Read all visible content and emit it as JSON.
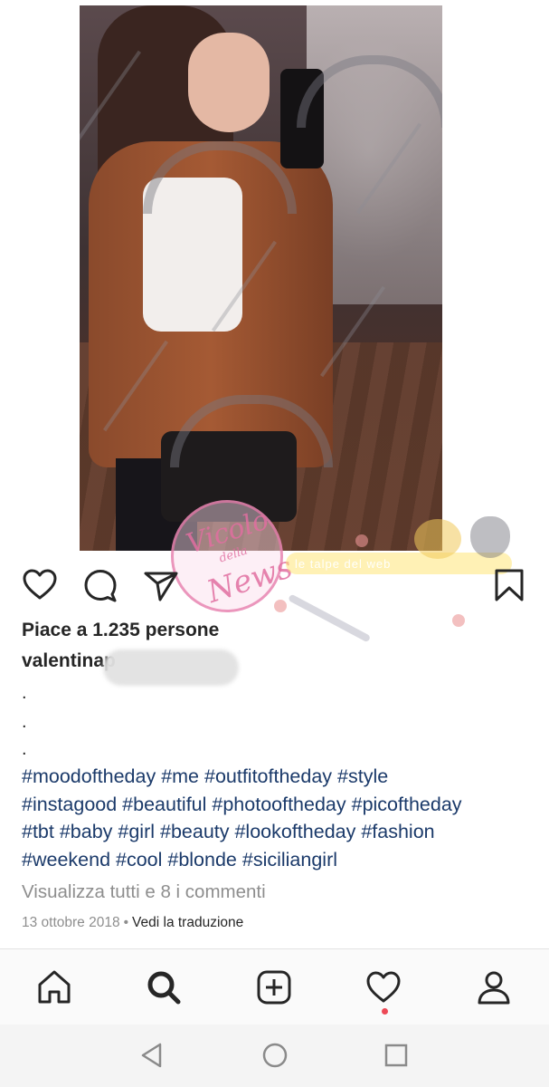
{
  "post": {
    "likes_text": "Piace a 1.235 persone",
    "username_visible": "valentinap",
    "caption_dots": [
      ".",
      ".",
      "."
    ],
    "hashtag_lines": [
      "#moodoftheday #me #outfitoftheday #style",
      "#instagood #beautiful #photooftheday #picoftheday",
      "#tbt #baby #girl #beauty #lookoftheday #fashion",
      "#weekend #cool #blonde #siciliangirl"
    ],
    "view_comments": "Visualizza tutti e 8 i commenti",
    "date": "13 ottobre 2018",
    "separator": "•",
    "translate_label": "Vedi la traduzione"
  },
  "watermark": {
    "line1": "Vicolo",
    "line2": "della",
    "line3": "News",
    "band_text": "le talpe del web"
  },
  "icons": {
    "like": "heart-icon",
    "comment": "comment-icon",
    "share": "send-icon",
    "save": "bookmark-icon",
    "nav_home": "home-icon",
    "nav_search": "search-icon",
    "nav_add": "add-post-icon",
    "nav_activity": "activity-heart-icon",
    "nav_profile": "profile-icon",
    "sys_back": "back-triangle-icon",
    "sys_home": "home-circle-icon",
    "sys_recent": "recents-square-icon"
  },
  "colors": {
    "text": "#262626",
    "hashtag": "#1b3a6a",
    "muted": "#8e8e8e",
    "notification": "#ed4956"
  }
}
